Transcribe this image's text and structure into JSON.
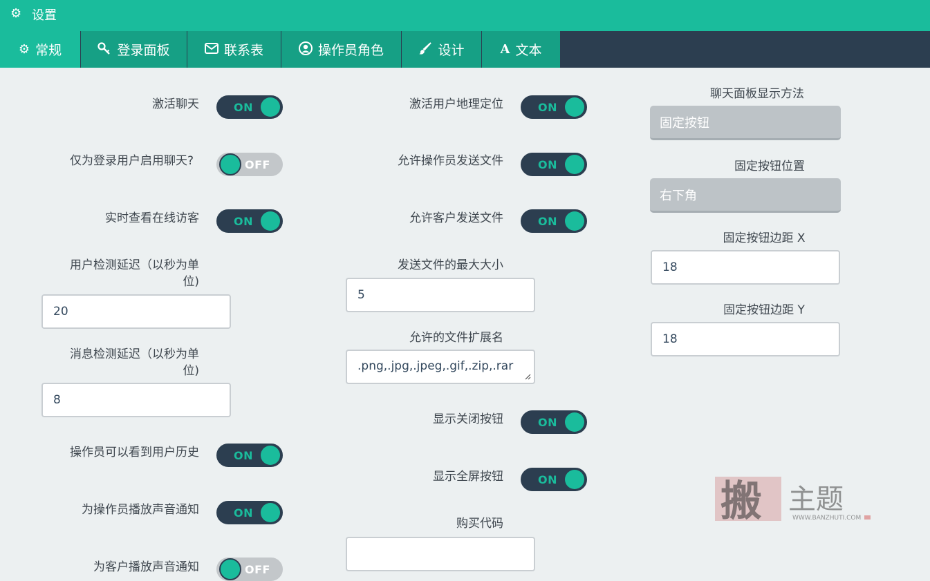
{
  "header": {
    "title": "设置",
    "icon": "gears-icon"
  },
  "tabs": [
    {
      "label": "常规",
      "icon": "gears-icon",
      "active": true
    },
    {
      "label": "登录面板",
      "icon": "key-icon"
    },
    {
      "label": "联系表",
      "icon": "envelope-icon"
    },
    {
      "label": "操作员角色",
      "icon": "user-circle-icon"
    },
    {
      "label": "设计",
      "icon": "paintbrush-icon"
    },
    {
      "label": "文本",
      "icon": "font-icon"
    }
  ],
  "toggle_text": {
    "on": "ON",
    "off": "OFF"
  },
  "col1": {
    "activate_chat": {
      "label": "激活聊天",
      "state": "ON"
    },
    "logged_users_only": {
      "label": "仅为登录用户启用聊天?",
      "state": "OFF"
    },
    "realtime_visitors": {
      "label": "实时查看在线访客",
      "state": "ON"
    },
    "user_check_delay": {
      "label_line1": "用户检测延迟（以秒为单",
      "label_line2": "位)",
      "value": "20"
    },
    "message_check_delay": {
      "label_line1": "消息检测延迟（以秒为单",
      "label_line2": "位)",
      "value": "8"
    },
    "operator_history": {
      "label": "操作员可以看到用户历史",
      "state": "ON"
    },
    "operator_sound": {
      "label": "为操作员播放声音通知",
      "state": "ON"
    },
    "customer_sound": {
      "label": "为客户播放声音通知",
      "state": "OFF"
    }
  },
  "col2": {
    "geolocation": {
      "label": "激活用户地理定位",
      "state": "ON"
    },
    "operator_files": {
      "label": "允许操作员发送文件",
      "state": "ON"
    },
    "customer_files": {
      "label": "允许客户发送文件",
      "state": "ON"
    },
    "max_file_size": {
      "label": "发送文件的最大大小",
      "value": "5"
    },
    "allowed_extensions": {
      "label": "允许的文件扩展名",
      "value": ".png,.jpg,.jpeg,.gif,.zip,.rar"
    },
    "close_button": {
      "label": "显示关闭按钮",
      "state": "ON"
    },
    "fullscreen_button": {
      "label": "显示全屏按钮",
      "state": "ON"
    },
    "purchase_code": {
      "label": "购买代码",
      "value": ""
    }
  },
  "col3": {
    "display_method": {
      "label": "聊天面板显示方法",
      "value": "固定按钮"
    },
    "button_position": {
      "label": "固定按钮位置",
      "value": "右下角"
    },
    "margin_x": {
      "label": "固定按钮边距 X",
      "value": "18"
    },
    "margin_y": {
      "label": "固定按钮边距 Y",
      "value": "18"
    }
  },
  "watermark": {
    "glyph": "搬",
    "text": "主题",
    "url": "WWW.BANZHUTI.COM"
  },
  "colors": {
    "accent": "#1abc9c",
    "dark": "#2c3e50",
    "tab": "#16a085",
    "background": "#ecf0f1"
  }
}
